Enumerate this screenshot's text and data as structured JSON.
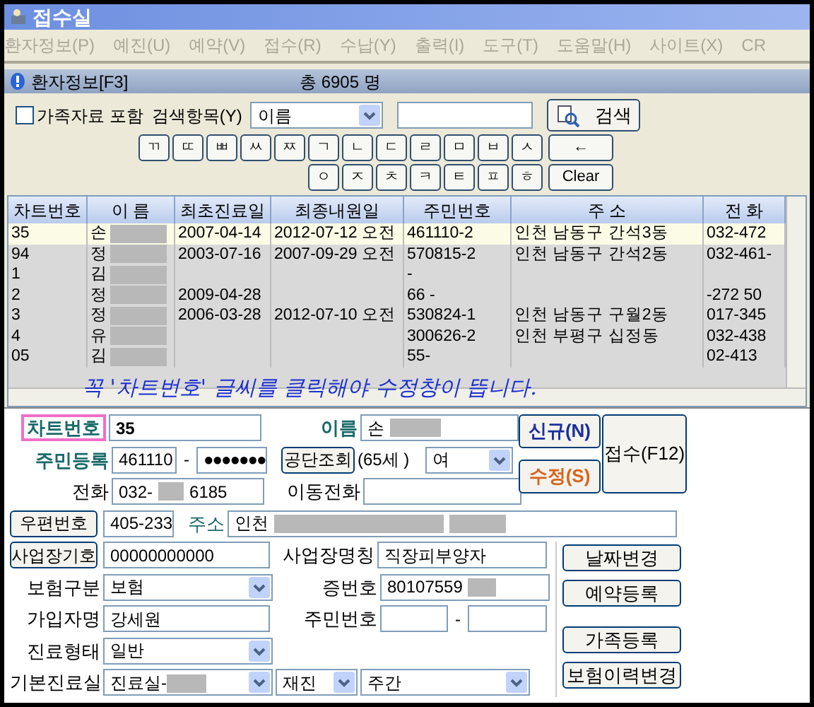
{
  "window": {
    "title": "접수실"
  },
  "menu": [
    {
      "label": "환자정보(P)",
      "disabled": true
    },
    {
      "label": "예진(U)",
      "disabled": true
    },
    {
      "label": "예약(V)",
      "disabled": true
    },
    {
      "label": "접수(R)",
      "disabled": true
    },
    {
      "label": "수납(Y)",
      "disabled": true
    },
    {
      "label": "출력(I)",
      "disabled": true
    },
    {
      "label": "도구(T)",
      "disabled": true
    },
    {
      "label": "도움말(H)",
      "disabled": true
    },
    {
      "label": "사이트(X)",
      "disabled": true
    },
    {
      "label": "CR",
      "disabled": true
    }
  ],
  "panel": {
    "title": "환자정보[F3]",
    "total": "총 6905 명"
  },
  "search": {
    "family": {
      "label": "가족자료 포함",
      "checked": false
    },
    "field_label": "검색항목(Y)",
    "field": {
      "value": "이름"
    },
    "button": "검색"
  },
  "keypad": {
    "row_1": [
      "ㄲ",
      "ㄸ",
      "ㅃ",
      "ㅆ",
      "ㅉ",
      "ㄱ",
      "ㄴ",
      "ㄷ",
      "ㄹ",
      "ㅁ",
      "ㅂ",
      "ㅅ"
    ],
    "row_2": [
      "ㅇ",
      "ㅈ",
      "ㅊ",
      "ㅋ",
      "ㅌ",
      "ㅍ",
      "ㅎ"
    ],
    "side": [
      "←",
      "Clear"
    ]
  },
  "table": {
    "columns": [
      "차트번호",
      "이 름",
      "최초진료일",
      "최종내원일",
      "주민번호",
      "주 소",
      "전 화"
    ],
    "rows": [
      {
        "selected": true,
        "cells": [
          "35",
          "손",
          "2007-04-14",
          "2012-07-12 오전",
          "461110-2",
          "인천 남동구 간석3동",
          "032-472"
        ]
      },
      {
        "selected": false,
        "cells": [
          "94",
          "정",
          "2003-07-16",
          "2007-09-29 오전",
          "570815-2",
          "인천 남동구 간석2동",
          "032-461-"
        ]
      },
      {
        "selected": false,
        "cells": [
          "1",
          "김",
          null,
          null,
          "-",
          null,
          null
        ]
      },
      {
        "selected": false,
        "cells": [
          "2",
          "정",
          "2009-04-28",
          null,
          "66 -",
          null,
          "-272 50"
        ]
      },
      {
        "selected": false,
        "cells": [
          "3",
          "정",
          "2006-03-28",
          "2012-07-10 오전",
          "530824-1",
          "인천 남동구 구월2동",
          "017-345"
        ]
      },
      {
        "selected": false,
        "cells": [
          "4",
          "유",
          null,
          null,
          "300626-2",
          "인천 부평구 십정동",
          "032-438"
        ]
      },
      {
        "selected": false,
        "cells": [
          "05",
          "김",
          null,
          null,
          "55-",
          null,
          "02-413"
        ]
      }
    ]
  },
  "annotation": "꼭 '차트번호' 글씨를 클릭해야 수정창이 뜹니다.",
  "form": {
    "chart_no": {
      "label": "차트번호",
      "highlighted": true,
      "value": "35"
    },
    "name": {
      "label": "이름",
      "value": "손"
    },
    "resident": {
      "label": "주민등록",
      "front": "461110",
      "separator": "-",
      "back": "●●●●●●●",
      "lookup_button": "공단조회",
      "age": "(65세 )",
      "sex": "여"
    },
    "phone": {
      "label": "전화",
      "prefix": "032-",
      "suffix": "6185"
    },
    "mobile": {
      "label": "이동전화"
    },
    "postcode": {
      "button": "우편번호",
      "value": "405-233"
    },
    "address": {
      "label": "주소",
      "value": "인천"
    },
    "workplace_code": {
      "button": "사업장기호",
      "value": "00000000000"
    },
    "workplace_name": {
      "label": "사업장명칭",
      "value": "직장피부양자"
    },
    "insurance_type": {
      "label": "보험구분",
      "value": "보험"
    },
    "card_no": {
      "label": "증번호",
      "value": "80107559"
    },
    "subscriber": {
      "label": "가입자명",
      "value": "강세원"
    },
    "subscriber_id": {
      "label": "주민번호",
      "separator": "-"
    },
    "care_type": {
      "label": "진료형태",
      "value": "일반"
    },
    "room": {
      "label": "기본진료실",
      "value": "진료실-",
      "visit": "재진",
      "shift": "주간"
    },
    "actions": [
      {
        "label": "신규(N)",
        "kind": "new"
      },
      {
        "label": "수정(S)",
        "kind": "edit"
      },
      {
        "label": "접수(F12)",
        "kind": "receive"
      }
    ],
    "side_buttons": [
      "날짜변경",
      "예약등록",
      "가족등록",
      "보험이력변경"
    ]
  }
}
